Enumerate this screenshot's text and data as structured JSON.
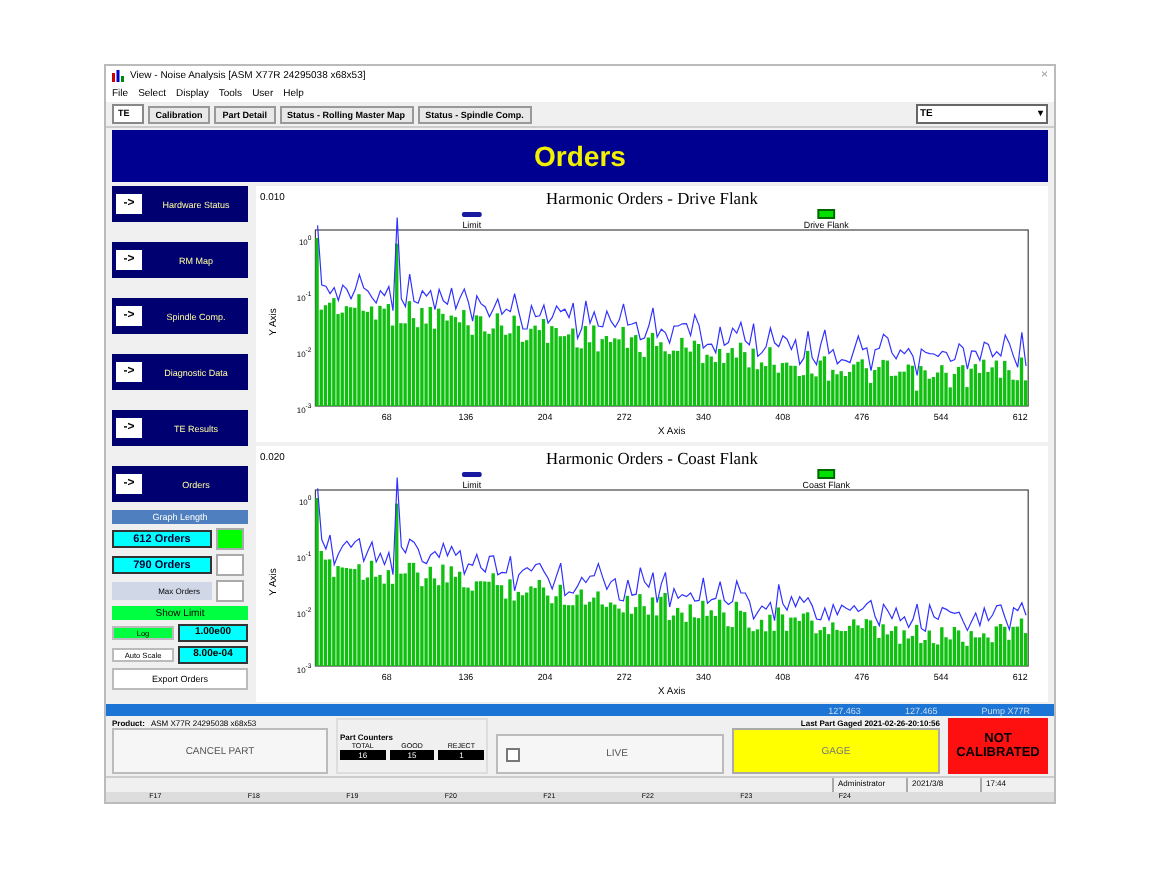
{
  "window": {
    "title": "View - Noise Analysis [ASM X77R 24295038 x68x53]",
    "close": "×"
  },
  "menu": [
    "File",
    "Select",
    "Display",
    "Tools",
    "User",
    "Help"
  ],
  "toolbar": {
    "station": "TE",
    "tabs": [
      {
        "label": "Calibration",
        "selected": false
      },
      {
        "label": "Part Detail",
        "selected": false
      },
      {
        "label": "Status - Rolling Master Map",
        "selected": false
      },
      {
        "label": "Status - Spindle Comp.",
        "selected": false
      }
    ],
    "dropdown": "TE",
    "caret": "▾"
  },
  "banner": "Orders",
  "nav": [
    {
      "arrow": "->",
      "label": "Hardware Status"
    },
    {
      "arrow": "->",
      "label": "RM Map"
    },
    {
      "arrow": "->",
      "label": "Spindle Comp."
    },
    {
      "arrow": "->",
      "label": "Diagnostic Data"
    },
    {
      "arrow": "->",
      "label": "TE Results"
    },
    {
      "arrow": "->",
      "label": "Orders"
    }
  ],
  "graph_length": {
    "header": "Graph Length",
    "options": [
      {
        "label": "612 Orders",
        "selected": true
      },
      {
        "label": "790 Orders",
        "selected": false
      }
    ],
    "max_orders": {
      "label": "Max Orders",
      "selected": false
    }
  },
  "show_limit": {
    "label": "Show Limit",
    "on": true
  },
  "scale": [
    {
      "label": "Log",
      "on": true,
      "value": "1.00e00"
    },
    {
      "label": "Auto Scale",
      "on": false,
      "value": "8.00e-04"
    }
  ],
  "export": "Export Orders",
  "charts": [
    {
      "corner": "0.010",
      "title": "Harmonic Orders - Drive Flank",
      "legend": [
        {
          "label": "Limit",
          "kind": "line",
          "color": "#1a1aa0"
        },
        {
          "label": "Drive Flank",
          "kind": "bar",
          "color": "#00e000"
        }
      ],
      "ylabel": "Y Axis",
      "xlabel": "X Axis",
      "yticks": [
        "10$^{0}$",
        "10$^{-1}$",
        "10$^{-2}$",
        "10$^{-3}$"
      ],
      "xticks": [
        "68",
        "136",
        "204",
        "272",
        "340",
        "408",
        "476",
        "544",
        "612"
      ]
    },
    {
      "corner": "0.020",
      "title": "Harmonic Orders - Coast Flank",
      "legend": [
        {
          "label": "Limit",
          "kind": "line",
          "color": "#1a1aa0"
        },
        {
          "label": "Coast Flank",
          "kind": "bar",
          "color": "#00e000"
        }
      ],
      "ylabel": "Y Axis",
      "xlabel": "X Axis",
      "yticks": [
        "10$^{0}$",
        "10$^{-1}$",
        "10$^{-2}$",
        "10$^{-3}$"
      ],
      "xticks": [
        "68",
        "136",
        "204",
        "272",
        "340",
        "408",
        "476",
        "544",
        "612"
      ]
    }
  ],
  "readings": [
    "127.463",
    "127.465",
    "Pump X77R"
  ],
  "product": {
    "label": "Product:",
    "value": "ASM X77R 24295038 x68x53"
  },
  "cancel": "CANCEL PART",
  "counters": {
    "title": "Part Counters",
    "items": [
      {
        "label": "TOTAL",
        "value": "16"
      },
      {
        "label": "GOOD",
        "value": "15"
      },
      {
        "label": "REJECT",
        "value": "1"
      }
    ]
  },
  "live": {
    "label": "LIVE",
    "checked": false
  },
  "last_part": "Last Part Gaged 2021-02-26-20:10:56",
  "gage": "GAGE",
  "calibration": "NOT CALIBRATED",
  "status": [
    "Administrator",
    "2021/3/8",
    "17:44"
  ],
  "fkeys": [
    "F17",
    "F18",
    "F19",
    "F20",
    "F21",
    "F22",
    "F23",
    "F24"
  ]
}
